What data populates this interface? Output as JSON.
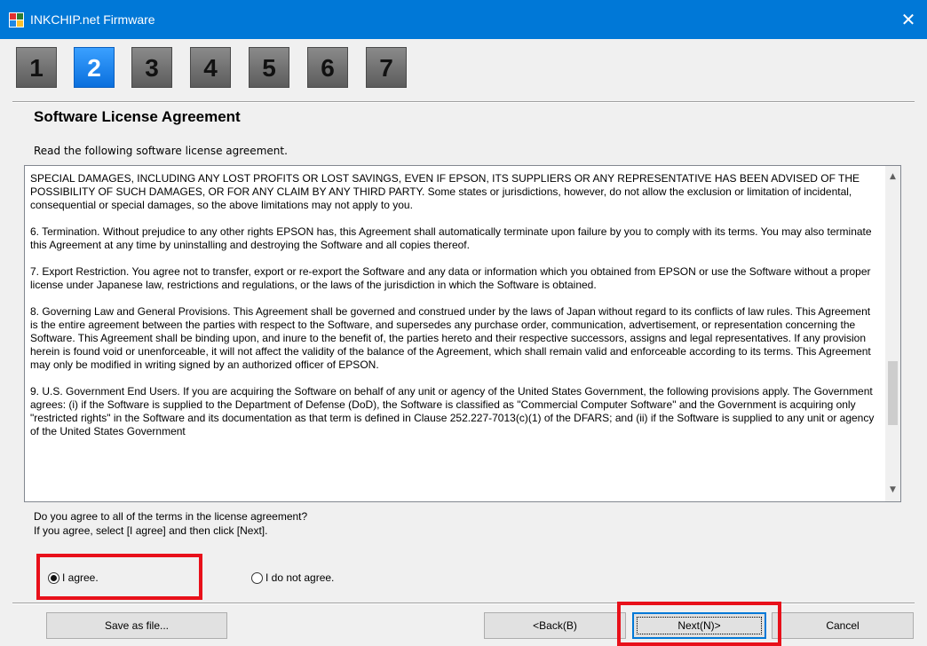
{
  "window": {
    "title": "INKCHIP.net Firmware",
    "close_glyph": "✕",
    "title_bar_color": "#0078d7"
  },
  "steps": {
    "items": [
      "1",
      "2",
      "3",
      "4",
      "5",
      "6",
      "7"
    ],
    "active": "2"
  },
  "heading": "Software License Agreement",
  "intro": "Read the following software license agreement.",
  "license": {
    "paragraphs": [
      "SPECIAL DAMAGES, INCLUDING ANY LOST PROFITS OR LOST SAVINGS, EVEN IF EPSON, ITS SUPPLIERS OR ANY REPRESENTATIVE HAS BEEN ADVISED OF THE POSSIBILITY OF SUCH DAMAGES, OR FOR ANY CLAIM BY ANY THIRD PARTY. Some states or jurisdictions, however, do not allow the exclusion or limitation of incidental, consequential or special damages, so the above limitations may not apply to you.",
      "6. Termination. Without prejudice to any other rights EPSON has, this Agreement shall automatically terminate upon failure by you to comply with its terms. You may also terminate this Agreement at any time by uninstalling and destroying the Software and all copies thereof.",
      "7. Export Restriction. You agree not to transfer, export or re-export the Software and any data or information which you obtained from EPSON or use the Software without a proper license under Japanese law, restrictions and regulations, or the laws of the jurisdiction in which the Software is obtained.",
      "8. Governing Law and General Provisions. This Agreement shall be governed and construed under by the laws of Japan without regard to its conflicts of law rules. This Agreement is the entire agreement between the parties with respect to the Software, and supersedes any purchase order, communication, advertisement, or representation concerning the Software. This Agreement shall be binding upon, and inure to the benefit of, the parties hereto and their respective successors, assigns and legal representatives. If any provision herein is found void or unenforceable, it will not affect the validity of the balance of the Agreement, which shall remain valid and enforceable according to its terms. This Agreement may only be modified in writing signed by an authorized officer of EPSON.",
      "9. U.S. Government End Users. If you are acquiring the Software on behalf of any unit or agency of the United States Government, the following provisions apply. The Government agrees: (i) if the Software is supplied to the Department of Defense (DoD), the Software is classified as \"Commercial Computer Software\" and the Government is acquiring only \"restricted rights\" in the Software and its documentation as that term is defined in Clause 252.227-7013(c)(1) of the DFARS; and (ii) if the Software is supplied to any unit or agency of the United States Government"
    ],
    "scroll_up_glyph": "▲",
    "scroll_down_glyph": "▼"
  },
  "question": {
    "line1": "Do you agree to all of the terms in the license agreement?",
    "line2": "If you agree, select [I agree] and then click [Next]."
  },
  "options": {
    "agree": {
      "label": "I agree.",
      "checked": true
    },
    "disagree": {
      "label": "I do not agree.",
      "checked": false
    }
  },
  "buttons": {
    "save": "Save as file...",
    "back": "<Back(B)",
    "next": "Next(N)>",
    "cancel": "Cancel"
  },
  "highlight_color": "#e8101a"
}
